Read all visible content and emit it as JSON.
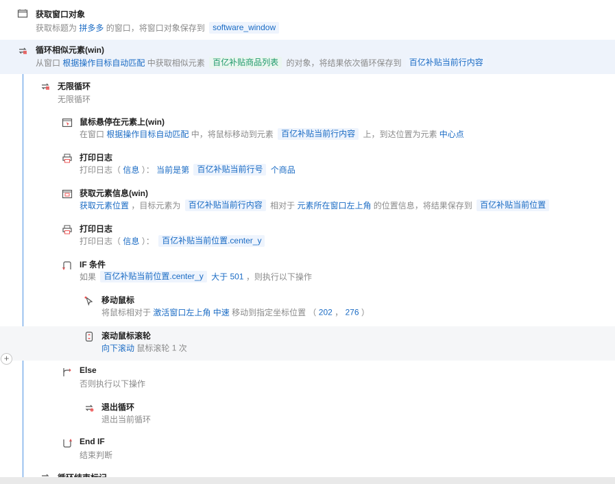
{
  "steps": {
    "s0": {
      "title": "获取窗口对象",
      "d": [
        "获取标题为",
        "拼多多",
        "的窗口，将窗口对象保存到",
        "software_window"
      ]
    },
    "s1": {
      "title": "循环相似元素(win)",
      "d": [
        "从窗口",
        "根据操作目标自动匹配",
        "中获取相似元素",
        "百亿补贴商品列表",
        "的对象，将结果依次循环保存到",
        "百亿补贴当前行内容"
      ]
    },
    "s2": {
      "title": "无限循环",
      "d": [
        "无限循环"
      ]
    },
    "s3": {
      "title": "鼠标悬停在元素上(win)",
      "d": [
        "在窗口",
        "根据操作目标自动匹配",
        "中，将鼠标移动到元素",
        "百亿补贴当前行内容",
        "上，到达位置为元素",
        "中心点"
      ]
    },
    "s4": {
      "title": "打印日志",
      "d": [
        "打印日志（",
        "信息",
        "）：",
        "当前是第",
        "百亿补贴当前行号",
        "个商品"
      ]
    },
    "s5": {
      "title": "获取元素信息(win)",
      "d": [
        "获取元素位置",
        "，目标元素为",
        "百亿补贴当前行内容",
        "相对于",
        "元素所在窗口左上角",
        "的位置信息，将结果保存到",
        "百亿补贴当前位置"
      ]
    },
    "s6": {
      "title": "打印日志",
      "d": [
        "打印日志（",
        "信息",
        "）：",
        "百亿补贴当前位置.center_y"
      ]
    },
    "s7": {
      "title": "IF 条件",
      "d": [
        "如果",
        "百亿补贴当前位置.center_y",
        "大于",
        "501",
        "，则执行以下操作"
      ]
    },
    "s8": {
      "title": "移动鼠标",
      "d": [
        "将鼠标相对于",
        "激活窗口左上角",
        "中速",
        "移动到指定坐标位置 （",
        "202",
        "，",
        "276",
        "）"
      ]
    },
    "s9": {
      "title": "滚动鼠标滚轮",
      "d": [
        "向下滚动",
        "鼠标滚轮",
        "1",
        "次"
      ]
    },
    "s10": {
      "title": "Else",
      "d": [
        "否则执行以下操作"
      ]
    },
    "s11": {
      "title": "退出循环",
      "d": [
        "退出当前循环"
      ]
    },
    "s12": {
      "title": "End IF",
      "d": [
        "结束判断"
      ]
    },
    "s13": {
      "title": "循环结束标记"
    }
  },
  "colors": {
    "accent": "#1a6bc4",
    "green": "#1f9a6a",
    "selected_bg": "#eef3fb",
    "line": "#4a90e2"
  },
  "icons": {
    "window": "window-icon",
    "loop": "loop-icon",
    "hover": "mouse-hover-icon",
    "log": "printer-icon",
    "info": "element-info-icon",
    "if": "if-branch-icon",
    "move": "mouse-move-icon",
    "scroll": "scroll-wheel-icon",
    "else": "else-branch-icon",
    "exit": "exit-loop-icon",
    "endif": "endif-icon"
  },
  "add_label": "+"
}
